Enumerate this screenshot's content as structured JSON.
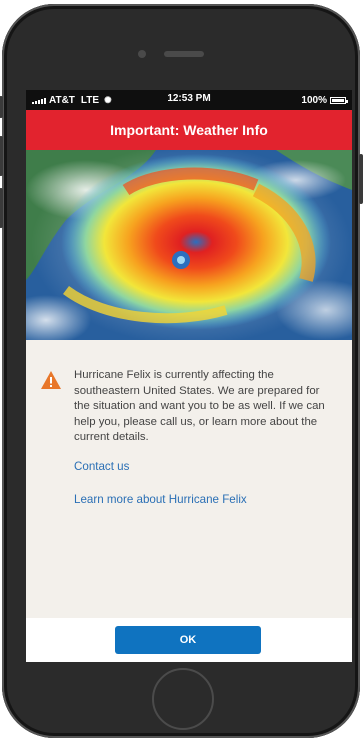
{
  "status_bar": {
    "carrier": "AT&T",
    "network": "LTE",
    "time": "12:53 PM",
    "battery": "100%"
  },
  "header": {
    "title": "Important: Weather Info"
  },
  "hero": {
    "icon": "hurricane-satellite-image"
  },
  "alert": {
    "icon": "warning-icon",
    "message": "Hurricane Felix is currently affecting the southeastern United States. We are prepared for the situation and want you to be as well. If we can help you, please call us, or learn more about the current details."
  },
  "links": {
    "contact": "Contact us",
    "learn_more": "Learn more about Hurricane Felix"
  },
  "footer": {
    "ok_label": "OK"
  },
  "colors": {
    "header_red": "#e2232e",
    "button_blue": "#0f73c0",
    "link_blue": "#2a6fb5",
    "warning_orange": "#e8772a",
    "content_bg": "#f3f0eb"
  }
}
